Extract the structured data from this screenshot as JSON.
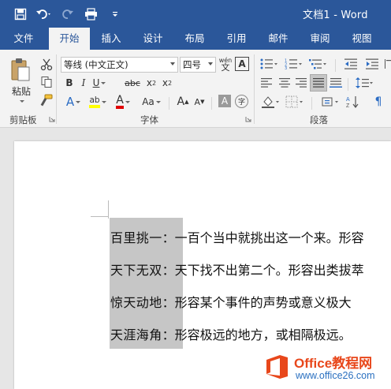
{
  "window": {
    "title": "文档1 - Word"
  },
  "qat": {
    "save_icon": "save-icon",
    "undo_icon": "undo-icon",
    "redo_icon": "redo-icon",
    "print_icon": "print-preview-icon",
    "customize_icon": "customize-qat-icon"
  },
  "tabs": [
    {
      "label": "文件",
      "active": false
    },
    {
      "label": "开始",
      "active": true
    },
    {
      "label": "插入",
      "active": false
    },
    {
      "label": "设计",
      "active": false
    },
    {
      "label": "布局",
      "active": false
    },
    {
      "label": "引用",
      "active": false
    },
    {
      "label": "邮件",
      "active": false
    },
    {
      "label": "审阅",
      "active": false
    },
    {
      "label": "视图",
      "active": false
    }
  ],
  "ribbon": {
    "clipboard": {
      "label": "剪贴板",
      "paste_label": "粘贴"
    },
    "font": {
      "label": "字体",
      "font_name": "等线 (中文正文)",
      "font_size": "四号",
      "wen_label": "wén",
      "wen_char": "文",
      "border_char": "A",
      "bold": "B",
      "italic": "I",
      "underline": "U",
      "strike": "abc",
      "subscript_base": "x",
      "subscript_mark": "2",
      "superscript_base": "x",
      "superscript_mark": "2",
      "effect": "A",
      "highlight": "ab",
      "font_color": "A",
      "change_case": "Aa",
      "grow": "A",
      "shrink": "A",
      "shade": "A",
      "enclose": "字",
      "highlight_color": "#ffff00",
      "font_color_value": "#e00000"
    },
    "paragraph": {
      "label": "段落"
    }
  },
  "document": {
    "lines": [
      {
        "term": "百里挑一",
        "sep": "：",
        "desc": "一百个当中就挑出这一个来。形容"
      },
      {
        "term": "天下无双",
        "sep": "：",
        "desc": "天下找不出第二个。形容出类拔萃"
      },
      {
        "term": "惊天动地",
        "sep": "：",
        "desc": "形容某个事件的声势或意义极大"
      },
      {
        "term": "天涯海角",
        "sep": "：",
        "desc": "形容极远的地方，或相隔极远。"
      }
    ]
  },
  "watermark": {
    "title": "Office教程网",
    "url": "www.office26.com"
  }
}
